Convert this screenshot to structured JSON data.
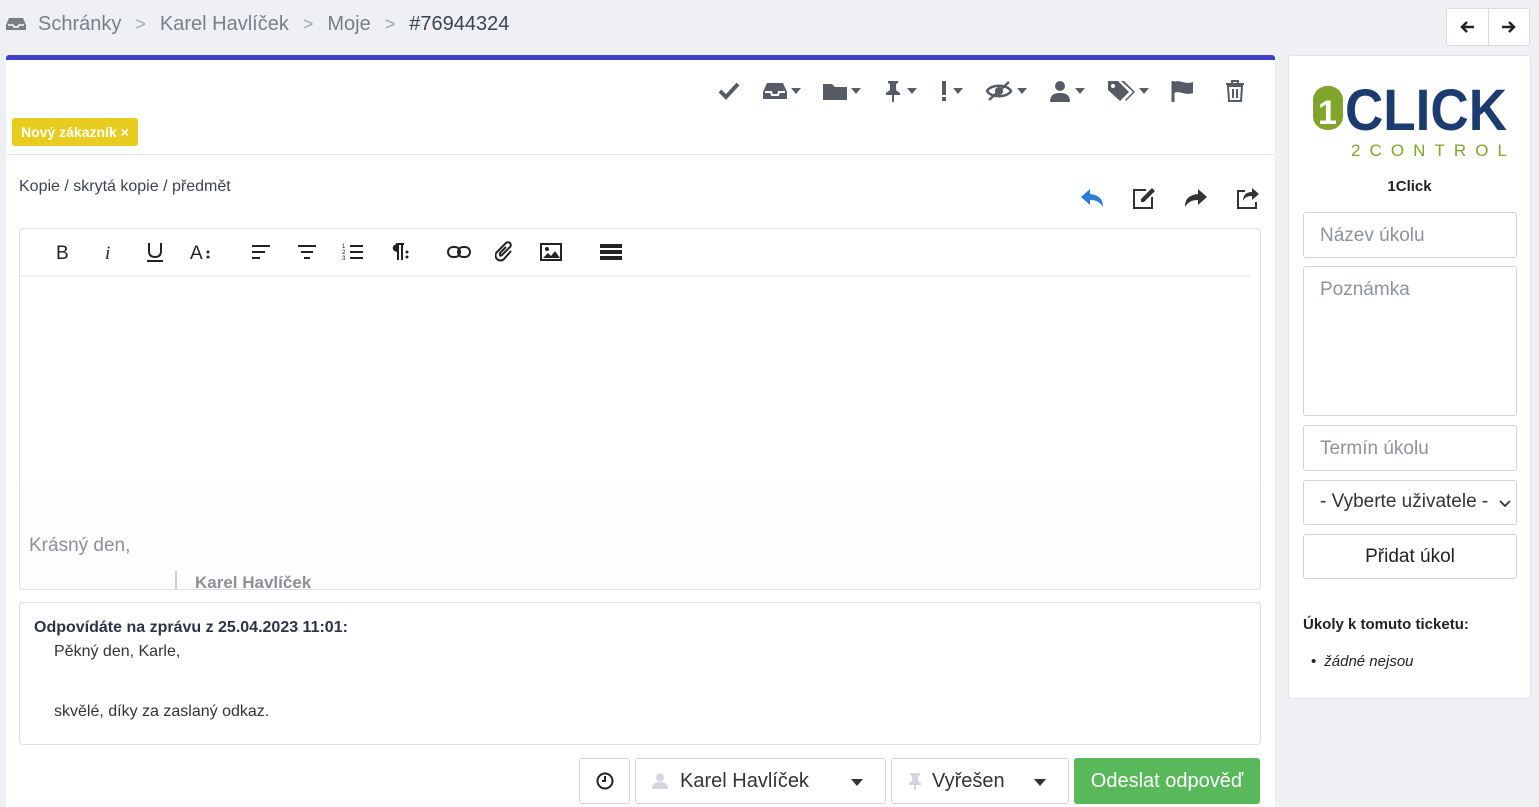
{
  "breadcrumb": {
    "items": [
      "Schránky",
      "Karel Havlíček",
      "Moje"
    ],
    "current": "#76944324",
    "separator": ">"
  },
  "ticket": {
    "tag": "Nový zákazník ×",
    "cc_link": "Kopie / skrytá kopie / předmět"
  },
  "editor": {
    "greeting": "Krásný den,",
    "signature": "Karel Havlíček"
  },
  "quote": {
    "header": "Odpovídáte na zprávu z 25.04.2023 11:01:",
    "lines": [
      "Pěkný den, Karle,",
      "skvělé, díky za zaslaný odkaz."
    ]
  },
  "footer": {
    "user": "Karel Havlíček",
    "status": "Vyřešen",
    "send": "Odeslat odpověď"
  },
  "sidebar": {
    "logo_text_main": "CLICK",
    "logo_text_num": "1",
    "logo_text_sub": "2CONTROL",
    "brand": "1Click",
    "task_name_placeholder": "Název úkolu",
    "note_placeholder": "Poznámka",
    "deadline_placeholder": "Termín úkolu",
    "user_select": "- Vyberte uživatele -",
    "add_task": "Přidat úkol",
    "tasks_heading": "Úkoly k tomuto ticketu:",
    "tasks_empty": "žádné nejsou"
  },
  "colors": {
    "accent": "#3f3fc8",
    "tag": "#e8cc1f",
    "send": "#59b95a",
    "reply_icon": "#2d7fd6",
    "logo_green": "#7fa52a",
    "logo_blue": "#1c3b6e"
  }
}
